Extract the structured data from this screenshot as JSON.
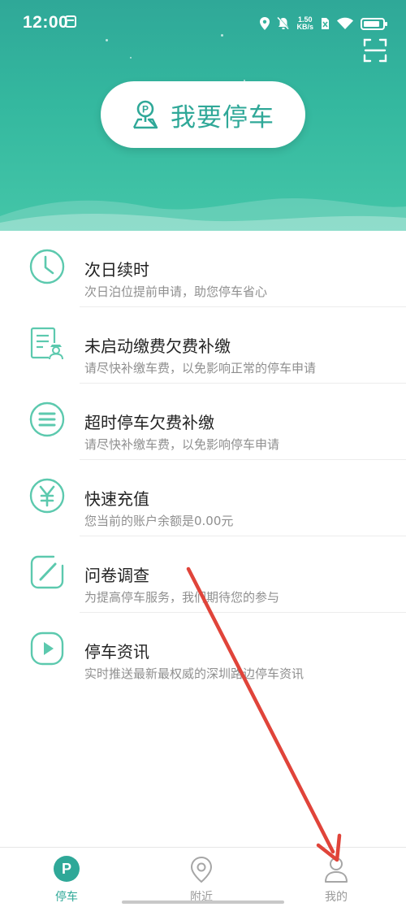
{
  "status_bar": {
    "time": "12:00",
    "speed_value": "1.50",
    "speed_unit": "KB/s"
  },
  "header": {
    "park_button_label": "我要停车",
    "icons": {
      "scan": "scan-icon",
      "park": "parking-location-icon"
    }
  },
  "menu": {
    "items": [
      {
        "title": "次日续时",
        "subtitle": "次日泊位提前申请，助您停车省心",
        "icon": "clock-icon"
      },
      {
        "title": "未启动缴费欠费补缴",
        "subtitle": "请尽快补缴车费，以免影响正常的停车申请",
        "icon": "bill-officer-icon"
      },
      {
        "title": "超时停车欠费补缴",
        "subtitle": "请尽快补缴车费，以免影响停车申请",
        "icon": "list-icon"
      },
      {
        "title": "快速充值",
        "subtitle": "您当前的账户余额是0.00元",
        "icon": "yen-icon"
      },
      {
        "title": "问卷调查",
        "subtitle": "为提高停车服务，我们期待您的参与",
        "icon": "survey-icon"
      },
      {
        "title": "停车资讯",
        "subtitle": "实时推送最新最权威的深圳路边停车资讯",
        "icon": "play-icon"
      }
    ]
  },
  "tabbar": {
    "tabs": [
      {
        "label": "停车",
        "active": true,
        "icon": "parking-tab-icon"
      },
      {
        "label": "附近",
        "active": false,
        "icon": "location-pin-icon"
      },
      {
        "label": "我的",
        "active": false,
        "icon": "user-icon"
      }
    ]
  },
  "colors": {
    "accent": "#2fa898",
    "icon_accent": "#5cc9ae",
    "annotation_arrow": "#e0443a",
    "inactive_tab": "#9a9a9a"
  }
}
